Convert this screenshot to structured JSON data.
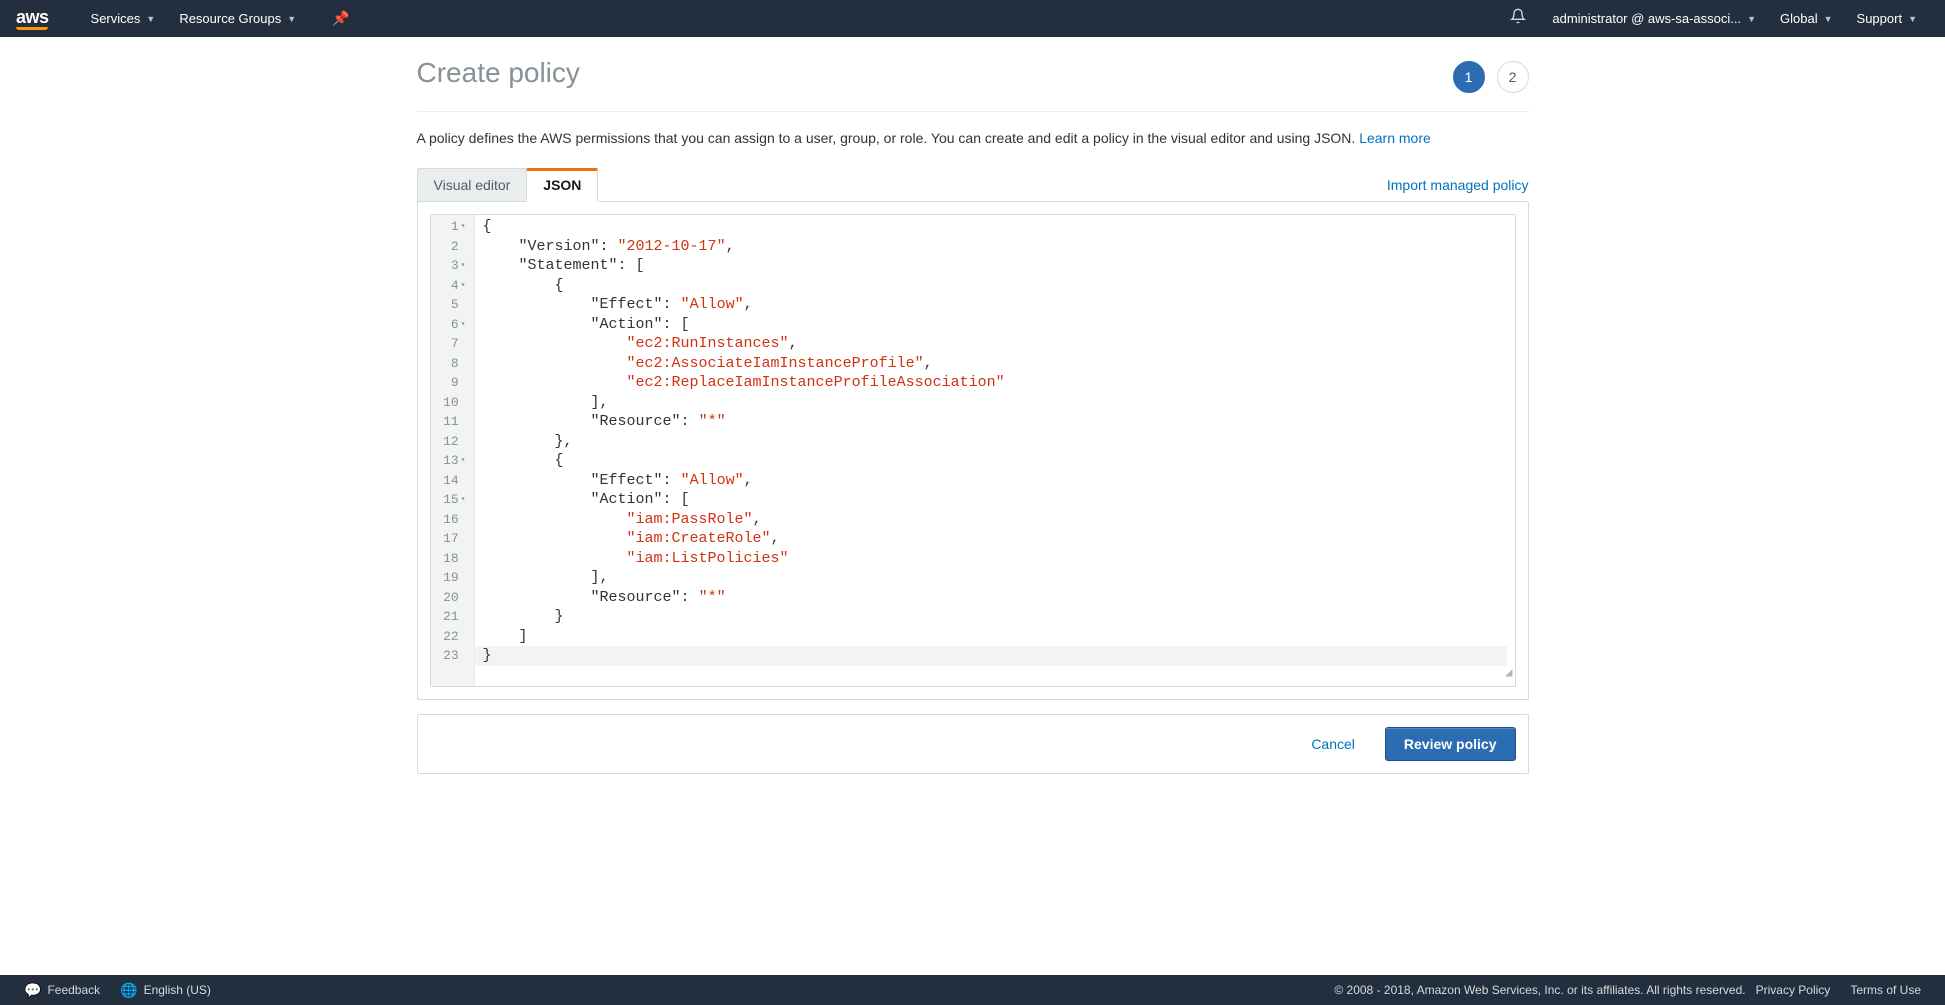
{
  "nav": {
    "logo": "aws",
    "services": "Services",
    "resource_groups": "Resource Groups",
    "account": "administrator @ aws-sa-associ...",
    "region": "Global",
    "support": "Support"
  },
  "page": {
    "title": "Create policy",
    "description_prefix": "A policy defines the AWS permissions that you can assign to a user, group, or role. You can create and edit a policy in the visual editor and using JSON. ",
    "learn_more": "Learn more"
  },
  "steps": {
    "s1": "1",
    "s2": "2",
    "active": 1
  },
  "tabs": {
    "visual": "Visual editor",
    "json": "JSON",
    "import": "Import managed policy"
  },
  "editor": {
    "gutter": [
      "1",
      "2",
      "3",
      "4",
      "5",
      "6",
      "7",
      "8",
      "9",
      "10",
      "11",
      "12",
      "13",
      "14",
      "15",
      "16",
      "17",
      "18",
      "19",
      "20",
      "21",
      "22",
      "23"
    ],
    "foldable": [
      1,
      3,
      4,
      6,
      13,
      15
    ],
    "policy": {
      "Version": "2012-10-17",
      "Statement": [
        {
          "Effect": "Allow",
          "Action": [
            "ec2:RunInstances",
            "ec2:AssociateIamInstanceProfile",
            "ec2:ReplaceIamInstanceProfileAssociation"
          ],
          "Resource": "*"
        },
        {
          "Effect": "Allow",
          "Action": [
            "iam:PassRole",
            "iam:CreateRole",
            "iam:ListPolicies"
          ],
          "Resource": "*"
        }
      ]
    }
  },
  "actions": {
    "cancel": "Cancel",
    "review": "Review policy"
  },
  "footer": {
    "feedback": "Feedback",
    "language": "English (US)",
    "copyright": "© 2008 - 2018, Amazon Web Services, Inc. or its affiliates. All rights reserved.",
    "privacy": "Privacy Policy",
    "terms": "Terms of Use"
  }
}
